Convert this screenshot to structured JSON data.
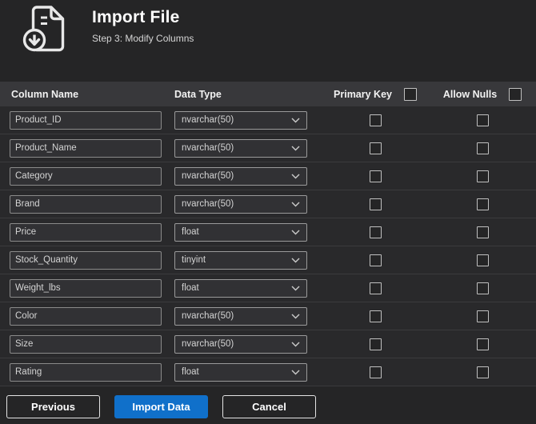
{
  "header": {
    "title": "Import File",
    "subtitle": "Step 3: Modify Columns"
  },
  "table": {
    "headers": [
      "Column Name",
      "Data Type",
      "Primary Key",
      "Allow Nulls"
    ],
    "select_all": {
      "primary_key": false,
      "allow_nulls": false
    },
    "rows": [
      {
        "name": "Product_ID",
        "type": "nvarchar(50)",
        "primary_key": false,
        "allow_nulls": false
      },
      {
        "name": "Product_Name",
        "type": "nvarchar(50)",
        "primary_key": false,
        "allow_nulls": false
      },
      {
        "name": "Category",
        "type": "nvarchar(50)",
        "primary_key": false,
        "allow_nulls": false
      },
      {
        "name": "Brand",
        "type": "nvarchar(50)",
        "primary_key": false,
        "allow_nulls": false
      },
      {
        "name": "Price",
        "type": "float",
        "primary_key": false,
        "allow_nulls": false
      },
      {
        "name": "Stock_Quantity",
        "type": "tinyint",
        "primary_key": false,
        "allow_nulls": false
      },
      {
        "name": "Weight_lbs",
        "type": "float",
        "primary_key": false,
        "allow_nulls": false
      },
      {
        "name": "Color",
        "type": "nvarchar(50)",
        "primary_key": false,
        "allow_nulls": false
      },
      {
        "name": "Size",
        "type": "nvarchar(50)",
        "primary_key": false,
        "allow_nulls": false
      },
      {
        "name": "Rating",
        "type": "float",
        "primary_key": false,
        "allow_nulls": false
      }
    ]
  },
  "footer": {
    "previous_label": "Previous",
    "import_label": "Import Data",
    "cancel_label": "Cancel"
  },
  "icons": {
    "header": "import-file-icon",
    "dropdown": "chevron-down-icon"
  },
  "colors": {
    "accent_blue": "#1070ca",
    "background": "#252526",
    "table_header_bg": "#38383b",
    "row_bg": "#29292b",
    "text": "#e6e6e6"
  }
}
